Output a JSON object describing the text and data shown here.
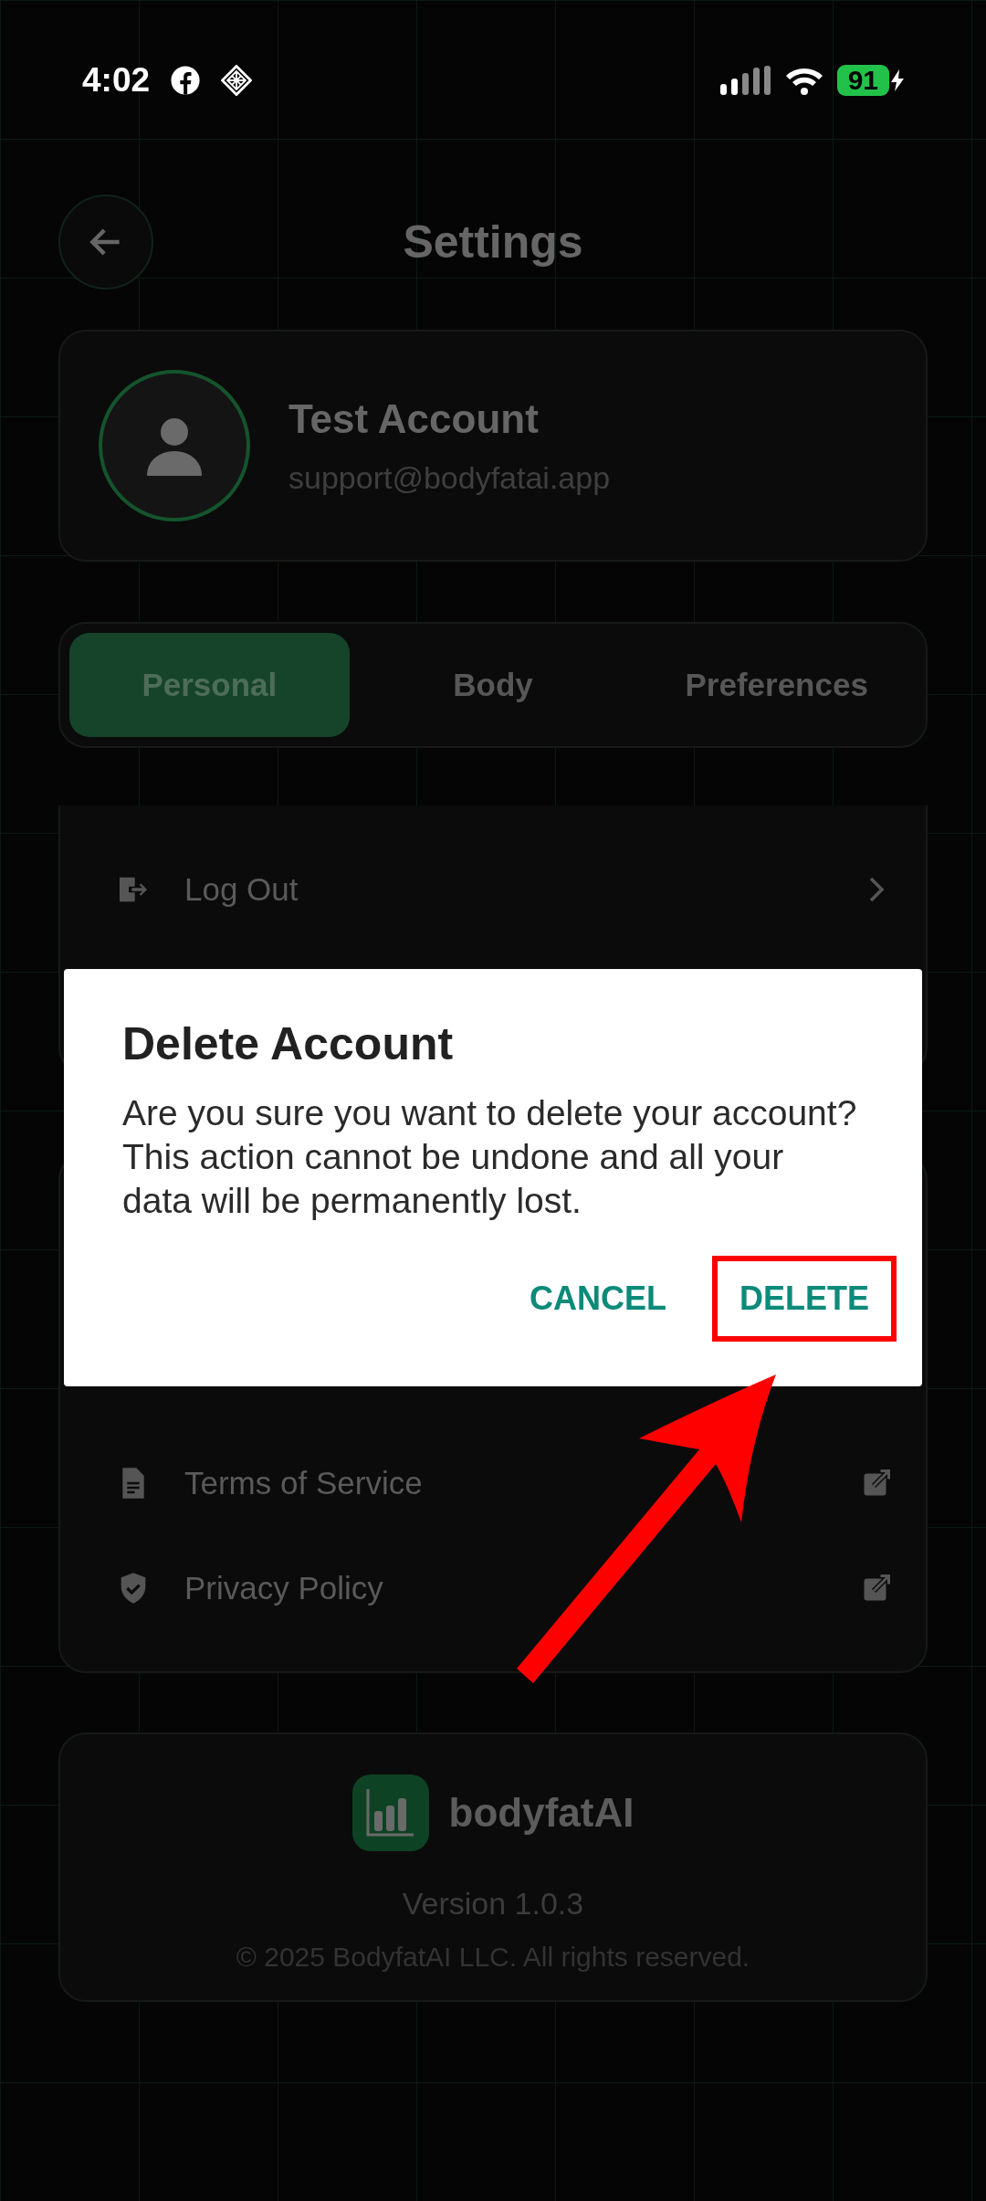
{
  "status_bar": {
    "time": "4:02",
    "battery": "91"
  },
  "header": {
    "title": "Settings"
  },
  "profile": {
    "name": "Test Account",
    "email": "support@bodyfatai.app"
  },
  "tabs": [
    {
      "label": "Personal",
      "selected": true
    },
    {
      "label": "Body",
      "selected": false
    },
    {
      "label": "Preferences",
      "selected": false
    }
  ],
  "account_items": [
    {
      "label": "Log Out"
    }
  ],
  "support_items": [
    {
      "label": "Terms of Service"
    },
    {
      "label": "Privacy Policy"
    }
  ],
  "footer": {
    "app_name": "bodyfatAI",
    "version": "Version 1.0.3",
    "copyright": "© 2025 BodyfatAI LLC. All rights reserved."
  },
  "dialog": {
    "title": "Delete Account",
    "message": "Are you sure you want to delete your account? This action cannot be undone and all your data will be permanently lost.",
    "buttons": [
      {
        "label": "CANCEL",
        "highlighted": false
      },
      {
        "label": "DELETE",
        "highlighted": true
      }
    ]
  }
}
